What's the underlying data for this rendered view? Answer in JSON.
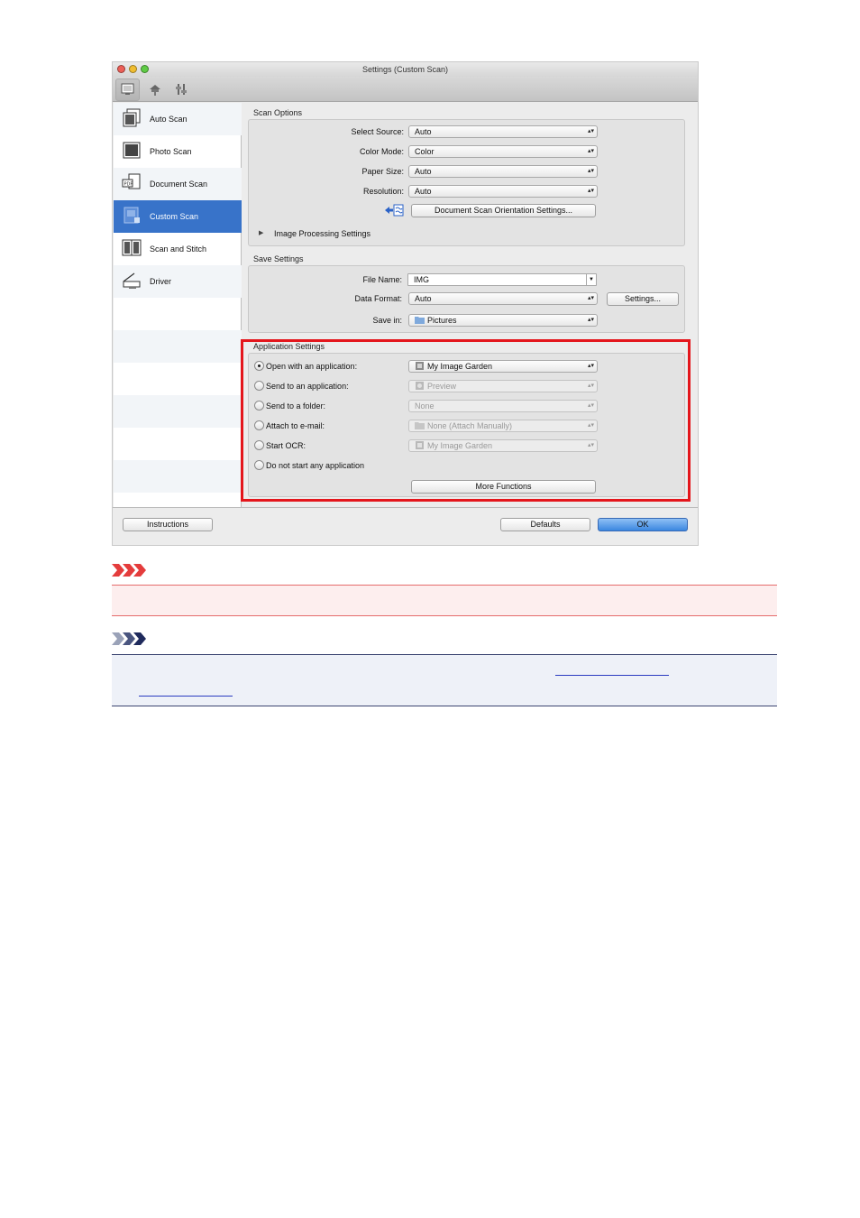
{
  "window": {
    "title": "Settings (Custom Scan)",
    "traffic_light_colors": [
      "#ec5f57",
      "#f0bd30",
      "#5fcb45"
    ]
  },
  "toolbar": {
    "icons": [
      "scan-from-computer-icon",
      "scan-from-operation-panel-icon",
      "general-settings-icon"
    ]
  },
  "sidebar": {
    "items": [
      {
        "label": "Auto Scan",
        "icon": "auto-scan-icon"
      },
      {
        "label": "Photo Scan",
        "icon": "photo-scan-icon"
      },
      {
        "label": "Document Scan",
        "icon": "document-scan-icon"
      },
      {
        "label": "Custom Scan",
        "icon": "custom-scan-icon",
        "selected": true
      },
      {
        "label": "Scan and Stitch",
        "icon": "scan-and-stitch-icon"
      },
      {
        "label": "Driver",
        "icon": "driver-icon"
      }
    ]
  },
  "scan_options": {
    "title": "Scan Options",
    "select_source_label": "Select Source:",
    "select_source_value": "Auto",
    "color_mode_label": "Color Mode:",
    "color_mode_value": "Color",
    "paper_size_label": "Paper Size:",
    "paper_size_value": "Auto",
    "resolution_label": "Resolution:",
    "resolution_value": "Auto",
    "orientation_button": "Document Scan Orientation Settings...",
    "image_processing": "Image Processing Settings"
  },
  "save_settings": {
    "title": "Save Settings",
    "file_name_label": "File Name:",
    "file_name_value": "IMG",
    "data_format_label": "Data Format:",
    "data_format_value": "Auto",
    "settings_button": "Settings...",
    "save_in_label": "Save in:",
    "save_in_value": "Pictures"
  },
  "application_settings": {
    "title": "Application Settings",
    "options": [
      {
        "label": "Open with an application:",
        "value": "My Image Garden",
        "selected": true,
        "enabled": true
      },
      {
        "label": "Send to an application:",
        "value": "Preview",
        "selected": false,
        "enabled": false
      },
      {
        "label": "Send to a folder:",
        "value": "None",
        "selected": false,
        "enabled": false
      },
      {
        "label": "Attach to e-mail:",
        "value": "None (Attach Manually)",
        "selected": false,
        "enabled": false
      },
      {
        "label": "Start OCR:",
        "value": "My Image Garden",
        "selected": false,
        "enabled": false
      },
      {
        "label": "Do not start any application",
        "selected": false
      }
    ],
    "more_functions_button": "More Functions",
    "highlight_color": "#e4161c"
  },
  "footer": {
    "instructions_button": "Instructions",
    "defaults_button": "Defaults",
    "ok_button": "OK"
  },
  "notices": {
    "important_icon": "important-icon",
    "important_color": "#e43c3c",
    "note_icon": "note-icon",
    "note_color": "#1f2a5c"
  }
}
